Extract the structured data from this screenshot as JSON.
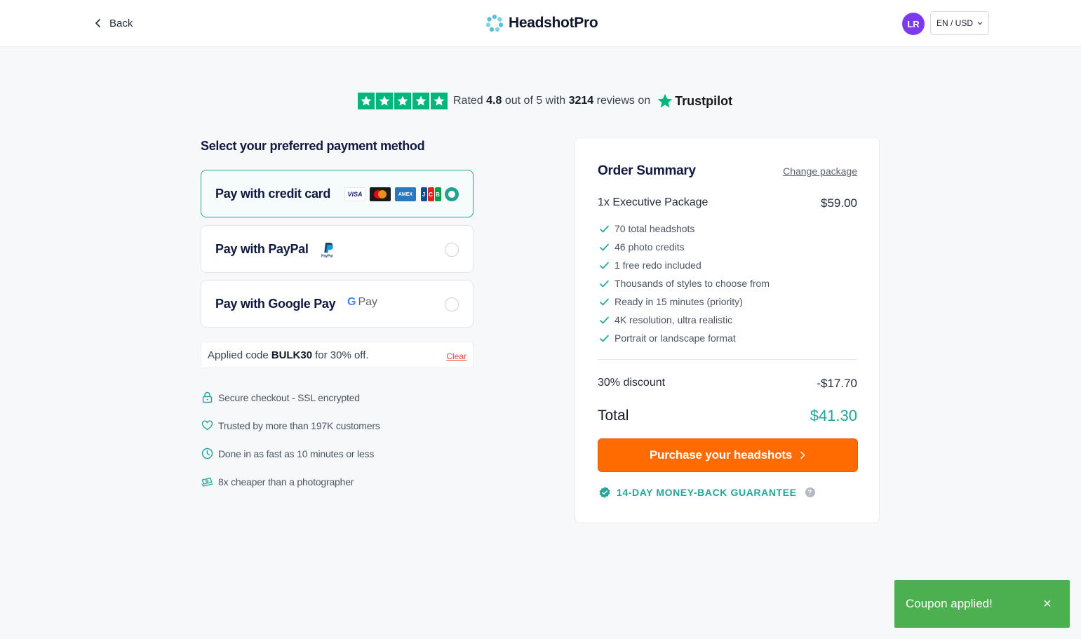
{
  "header": {
    "back_label": "Back",
    "brand": "HeadshotPro",
    "avatar_initials": "LR",
    "locale_label": "EN / USD"
  },
  "rating": {
    "prefix": "Rated",
    "score": "4.8",
    "middle": "out of 5 with",
    "count": "3214",
    "suffix": "reviews on",
    "platform": "Trustpilot"
  },
  "payment": {
    "title": "Select your preferred payment method",
    "options": [
      {
        "label": "Pay with credit card",
        "selected": true
      },
      {
        "label": "Pay with PayPal",
        "selected": false
      },
      {
        "label": "Pay with Google Pay",
        "selected": false
      }
    ],
    "card_brands": [
      "VISA",
      "Mastercard",
      "AMEX",
      "JCB"
    ],
    "gpay_text": "Pay"
  },
  "coupon": {
    "prefix": "Applied code",
    "code": "BULK30",
    "suffix": "for 30% off.",
    "clear_label": "Clear"
  },
  "trust": [
    {
      "icon": "lock-icon",
      "text": "Secure checkout - SSL encrypted"
    },
    {
      "icon": "heart-icon",
      "text": "Trusted by more than 197K customers"
    },
    {
      "icon": "clock-icon",
      "text": "Done in as fast as 10 minutes or less"
    },
    {
      "icon": "money-icon",
      "text": "8x cheaper than a photographer"
    }
  ],
  "summary": {
    "title": "Order Summary",
    "change_label": "Change package",
    "package_name": "1x Executive Package",
    "package_price": "$59.00",
    "features": [
      "70 total headshots",
      "46 photo credits",
      "1 free redo included",
      "Thousands of styles to choose from",
      "Ready in 15 minutes (priority)",
      "4K resolution, ultra realistic",
      "Portrait or landscape format"
    ],
    "discount_label": "30% discount",
    "discount_value": "-$17.70",
    "total_label": "Total",
    "total_value": "$41.30",
    "cta_label": "Purchase your headshots",
    "guarantee": "14-DAY MONEY-BACK GUARANTEE",
    "guarantee_help": "?"
  },
  "toast": {
    "message": "Coupon applied!",
    "close": "×"
  },
  "colors": {
    "accent": "#23a698",
    "cta": "#ff6b00",
    "trustpilot": "#00b67a",
    "toast": "#4caf50",
    "avatar": "#7c3aed"
  }
}
